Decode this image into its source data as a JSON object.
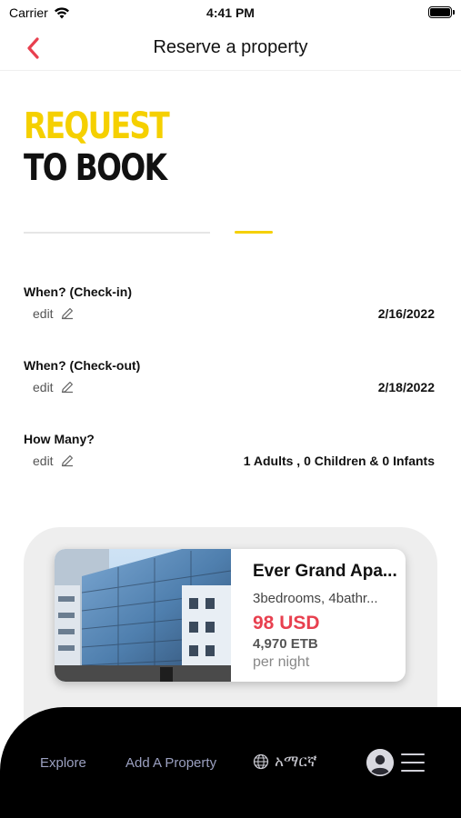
{
  "status_bar": {
    "carrier": "Carrier",
    "time": "4:41 PM",
    "wifi_icon": "wifi-icon",
    "battery_icon": "battery-icon"
  },
  "nav": {
    "title": "Reserve a property",
    "back_icon": "chevron-left-icon",
    "accent_color": "#e8404f"
  },
  "heading": {
    "line1": "REQUEST",
    "line2": "TO BOOK",
    "accent_color": "#f5d000"
  },
  "steps": {
    "current_step": 2
  },
  "fields": [
    {
      "label": "When? (Check-in)",
      "edit": "edit",
      "value": "2/16/2022"
    },
    {
      "label": "When? (Check-out)",
      "edit": "edit",
      "value": "2/18/2022"
    },
    {
      "label": "How Many?",
      "edit": "edit",
      "value": "1 Adults , 0 Children  & 0 Infants"
    }
  ],
  "property": {
    "name": "Ever Grand Apa...",
    "rooms": "3bedrooms, 4bathr...",
    "price_usd": "98 USD",
    "price_etb": "4,970 ETB",
    "per_night": "per night"
  },
  "bottom_nav": {
    "explore": "Explore",
    "add_property": "Add A Property",
    "language": "አማርኛ",
    "globe_icon": "globe-icon",
    "profile_icon": "user-avatar-icon",
    "menu_icon": "hamburger-menu-icon"
  }
}
